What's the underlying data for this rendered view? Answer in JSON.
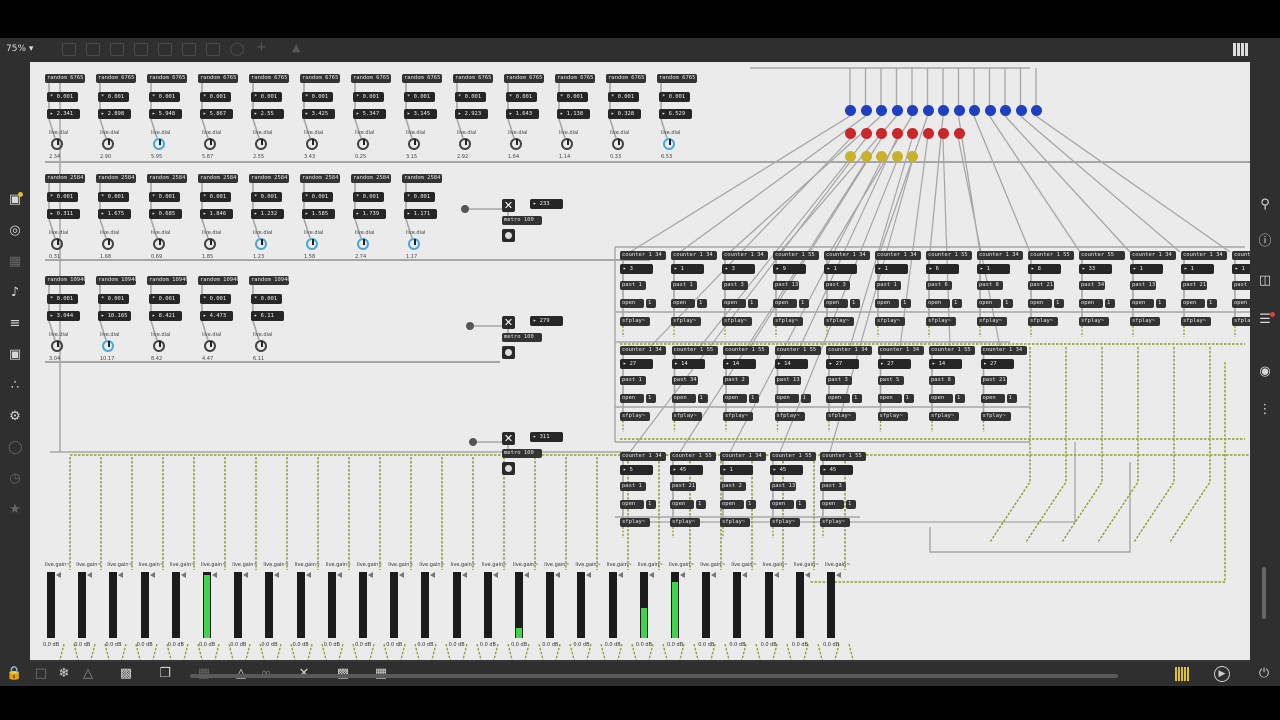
{
  "toolbar": {
    "zoom": "75% ▾"
  },
  "sidebars": {
    "left_icons": [
      "package-icon",
      "target-icon",
      "keyboard-icon",
      "music-note-icon",
      "playlist-icon",
      "image-icon",
      "paperclip-icon",
      "plug-icon",
      "disabled-circle-icon",
      "disabled-clock-icon",
      "star-icon"
    ],
    "right_icons": [
      "search-icon",
      "info-icon",
      "columns-icon",
      "list-icon",
      "camera-icon",
      "sliders-icon"
    ]
  },
  "bottom": {
    "icons": [
      "lock-icon",
      "presentation-icon",
      "snowflake-icon",
      "warning-icon",
      "chat-icon",
      "windows-icon",
      "grid-icon",
      "hierarchy-icon",
      "link-icon",
      "wrench-icon",
      "piano-icon",
      "keyboard-icon"
    ]
  },
  "patch": {
    "row1": {
      "random_label": "random 6765",
      "scale": "* 0.001",
      "values": [
        "2.341",
        "2.898",
        "5.948",
        "5.867",
        "2.55",
        "3.425",
        "5.347",
        "3.145",
        "2.923",
        "1.643",
        "1.138",
        "0.328",
        "6.529"
      ],
      "dial_label": "live.dial",
      "dial_values": [
        "2.34",
        "2.90",
        "5.95",
        "5.87",
        "2.55",
        "3.43",
        "0.25",
        "3.15",
        "2.92",
        "1.64",
        "1.14",
        "0.33",
        "6.53"
      ]
    },
    "row2": {
      "random_label": "random 2584",
      "scale": "* 0.001",
      "values": [
        "0.311",
        "1.675",
        "0.685",
        "1.846",
        "1.232",
        "1.585",
        "1.739",
        "1.171"
      ],
      "dial_label": "live.dial",
      "dial_values": [
        "0.31",
        "1.68",
        "0.69",
        "1.85",
        "1.23",
        "1.58",
        "2.74",
        "1.17"
      ]
    },
    "row3": {
      "random_label": "random 10946",
      "scale": "* 0.001",
      "values": [
        "3.044",
        "10.165",
        "8.421",
        "4.473",
        "6.11"
      ],
      "dial_label": "live.dial",
      "dial_values": [
        "3.04",
        "10.17",
        "8.42",
        "4.47",
        "6.11"
      ]
    },
    "metros": [
      {
        "value": "233",
        "metro": "metro 100"
      },
      {
        "value": "279",
        "metro": "metro 100"
      },
      {
        "value": "311",
        "metro": "metro 100"
      }
    ],
    "counters_top": [
      {
        "counter": "counter 1 34",
        "val": "3",
        "past": "past 1"
      },
      {
        "counter": "counter 1 34",
        "val": "1",
        "past": "past 1"
      },
      {
        "counter": "counter 1 34",
        "val": "3",
        "past": "past 3"
      },
      {
        "counter": "counter 1 55",
        "val": "9",
        "past": "past 13"
      },
      {
        "counter": "counter 1 34",
        "val": "1",
        "past": "past 3"
      },
      {
        "counter": "counter 1 34",
        "val": "1",
        "past": "past 1"
      },
      {
        "counter": "counter 1 55",
        "val": "6",
        "past": "past 6"
      },
      {
        "counter": "counter 1 34",
        "val": "1",
        "past": "past 8"
      },
      {
        "counter": "counter 1 55",
        "val": "8",
        "past": "past 21"
      },
      {
        "counter": "counter 55",
        "val": "33",
        "past": "past 34"
      },
      {
        "counter": "counter 1 34",
        "val": "1",
        "past": "past 13"
      },
      {
        "counter": "counter 1 34",
        "val": "1",
        "past": "past 21"
      },
      {
        "counter": "counter",
        "val": "1",
        "past": "past"
      }
    ],
    "counters_mid": [
      {
        "counter": "counter 1 34",
        "val": "27",
        "past": "past 1"
      },
      {
        "counter": "counter 1 55",
        "val": "14",
        "past": "past 34"
      },
      {
        "counter": "counter 1 55",
        "val": "14",
        "past": "past 2"
      },
      {
        "counter": "counter 1 55",
        "val": "14",
        "past": "past 13"
      },
      {
        "counter": "counter 1 34",
        "val": "27",
        "past": "past 3"
      },
      {
        "counter": "counter 1 34",
        "val": "27",
        "past": "past 5"
      },
      {
        "counter": "counter 1 55",
        "val": "14",
        "past": "past 8"
      },
      {
        "counter": "counter 1 34",
        "val": "27",
        "past": "past 21"
      }
    ],
    "counters_bot": [
      {
        "counter": "counter 1 34",
        "val": "5",
        "past": "past 1"
      },
      {
        "counter": "counter 1 55",
        "val": "45",
        "past": "past 21"
      },
      {
        "counter": "counter 1 34",
        "val": "1",
        "past": "past 2"
      },
      {
        "counter": "counter 1 55",
        "val": "45",
        "past": "past 13"
      },
      {
        "counter": "counter 1 55",
        "val": "45",
        "past": "past 3"
      }
    ],
    "open_label": "open",
    "sfplay_label": "sfplay~",
    "one_label": "1",
    "gain_label": "live.gain~",
    "db_label": "0.0 dB",
    "gain_count": 26,
    "gain_levels": [
      0,
      0,
      0,
      0,
      0,
      0.95,
      0,
      0,
      0,
      0,
      0,
      0,
      0,
      0,
      0,
      0.15,
      0,
      0,
      0,
      0.45,
      0.85,
      0,
      0,
      0,
      0,
      0
    ],
    "dot_colors": {
      "blue": "#1e3fbf",
      "red": "#c8282b",
      "yellow": "#c9b22a"
    },
    "dots": {
      "blue": 13,
      "red": 8,
      "yellow": 5
    }
  }
}
